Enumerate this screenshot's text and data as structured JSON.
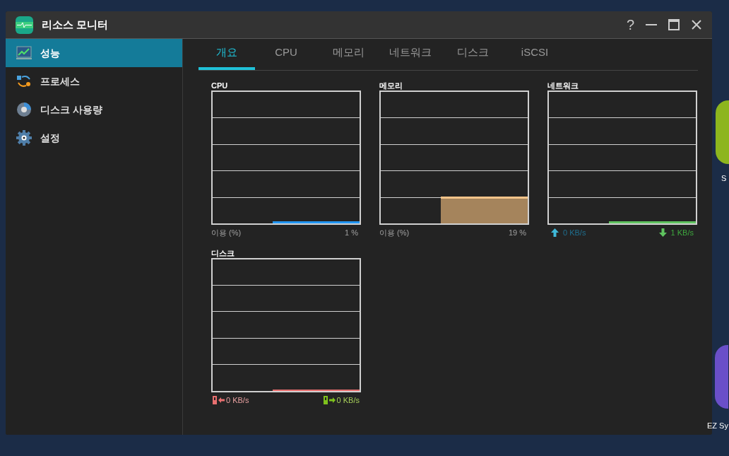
{
  "window": {
    "title": "리소스 모니터"
  },
  "title_buttons": [
    "?"
  ],
  "sidebar": {
    "items": [
      {
        "label": "성능",
        "selected": true
      },
      {
        "label": "프로세스",
        "selected": false
      },
      {
        "label": "디스크 사용량",
        "selected": false
      },
      {
        "label": "설정",
        "selected": false
      }
    ]
  },
  "tabs": [
    {
      "label": "개요",
      "selected": true
    },
    {
      "label": "CPU",
      "selected": false
    },
    {
      "label": "메모리",
      "selected": false
    },
    {
      "label": "네트워크",
      "selected": false
    },
    {
      "label": "디스크",
      "selected": false
    },
    {
      "label": "iSCSI",
      "selected": false
    }
  ],
  "charts": [
    {
      "kind": "cpu",
      "title": "CPU",
      "left_label": "이용 (%)",
      "right_label": "1 %"
    },
    {
      "kind": "memory",
      "title": "메모리",
      "left_label": "이용 (%)",
      "right_label": "19 %"
    },
    {
      "kind": "network",
      "title": "네트워크",
      "up": "0 KB/s",
      "down": "1 KB/s"
    },
    {
      "kind": "disk",
      "title": "디스크",
      "read": "0 KB/s",
      "write": "0 KB/s"
    }
  ],
  "desktop_icons": [
    {
      "label": "S"
    },
    {
      "label": "EZ Sy"
    }
  ]
}
